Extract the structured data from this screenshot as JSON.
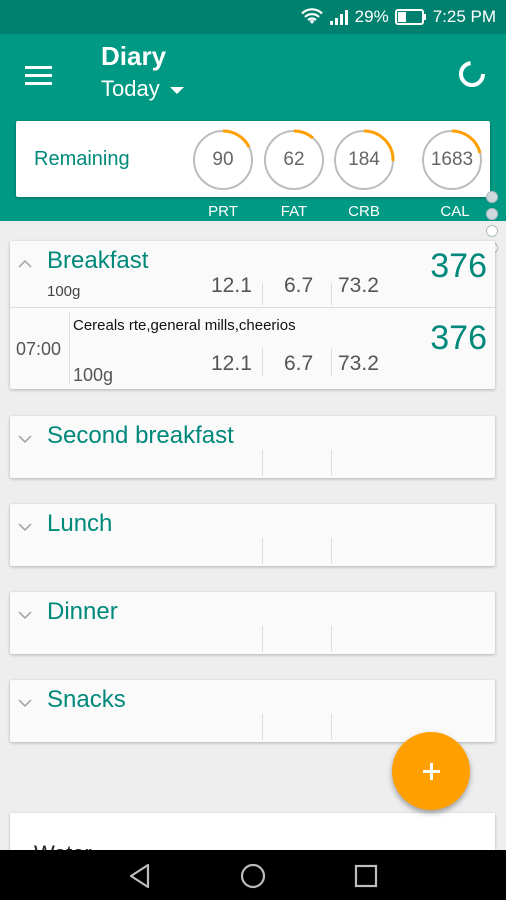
{
  "status_bar": {
    "battery": "29%",
    "time": "7:25 PM"
  },
  "app_bar": {
    "title": "Diary",
    "date_selector": "Today"
  },
  "remaining": {
    "label": "Remaining",
    "macros": [
      {
        "label": "PRT",
        "value": "90"
      },
      {
        "label": "FAT",
        "value": "62"
      },
      {
        "label": "CRB",
        "value": "184"
      },
      {
        "label": "CAL",
        "value": "1683"
      }
    ]
  },
  "meals": [
    {
      "name": "Breakfast",
      "weight": "100g",
      "protein": "12.1",
      "fat": "6.7",
      "carbs": "73.2",
      "calories": "376",
      "entries": [
        {
          "time": "07:00",
          "food": "Cereals rte,general mills,cheerios",
          "weight": "100g",
          "protein": "12.1",
          "fat": "6.7",
          "carbs": "73.2",
          "calories": "376"
        }
      ]
    },
    {
      "name": "Second breakfast"
    },
    {
      "name": "Lunch"
    },
    {
      "name": "Dinner"
    },
    {
      "name": "Snacks"
    }
  ],
  "water": {
    "label": "Water"
  },
  "colors": {
    "primary": "#009a84",
    "primary_dark": "#00806e",
    "accent": "#ffa000",
    "text_accent": "#00897b"
  },
  "icons": [
    "wifi-icon",
    "signal-icon",
    "battery-icon",
    "menu-icon",
    "sync-icon",
    "chevron-up-icon",
    "chevron-down-icon",
    "plus-icon",
    "back-icon",
    "home-icon",
    "recents-icon"
  ]
}
